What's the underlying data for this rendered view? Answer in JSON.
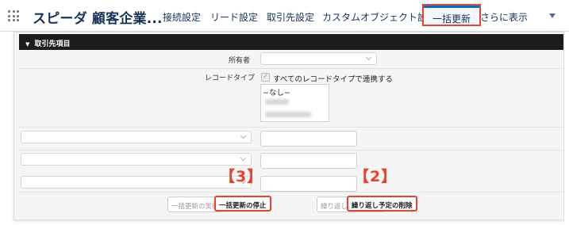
{
  "app": {
    "name": "スピーダ 顧客企業..."
  },
  "nav": {
    "items": [
      {
        "label": "接続設定"
      },
      {
        "label": "リード設定"
      },
      {
        "label": "取引先設定"
      },
      {
        "label": "カスタムオブジェクト設定"
      },
      {
        "label": "一括更新"
      }
    ],
    "more_label": "さらに表示"
  },
  "section": {
    "title": "取引先項目"
  },
  "form": {
    "owner_label": "所有者",
    "record_type_label": "レコードタイプ",
    "record_type_checkbox_label": "すべてのレコードタイプで連携する",
    "record_type_checked": true,
    "record_type_option_none": "−なし−"
  },
  "buttons": {
    "run_bulk": "一括更新の実行",
    "stop_bulk": "一括更新の停止",
    "register_schedule": "繰り返し予定の登録",
    "delete_schedule": "繰り返し予定の削除"
  },
  "callouts": {
    "three": "【3】",
    "two": "【2】"
  },
  "colors": {
    "highlight": "#e8412c",
    "active_tab_bar": "#0070d2",
    "header_bg": "#1c1c1c"
  }
}
